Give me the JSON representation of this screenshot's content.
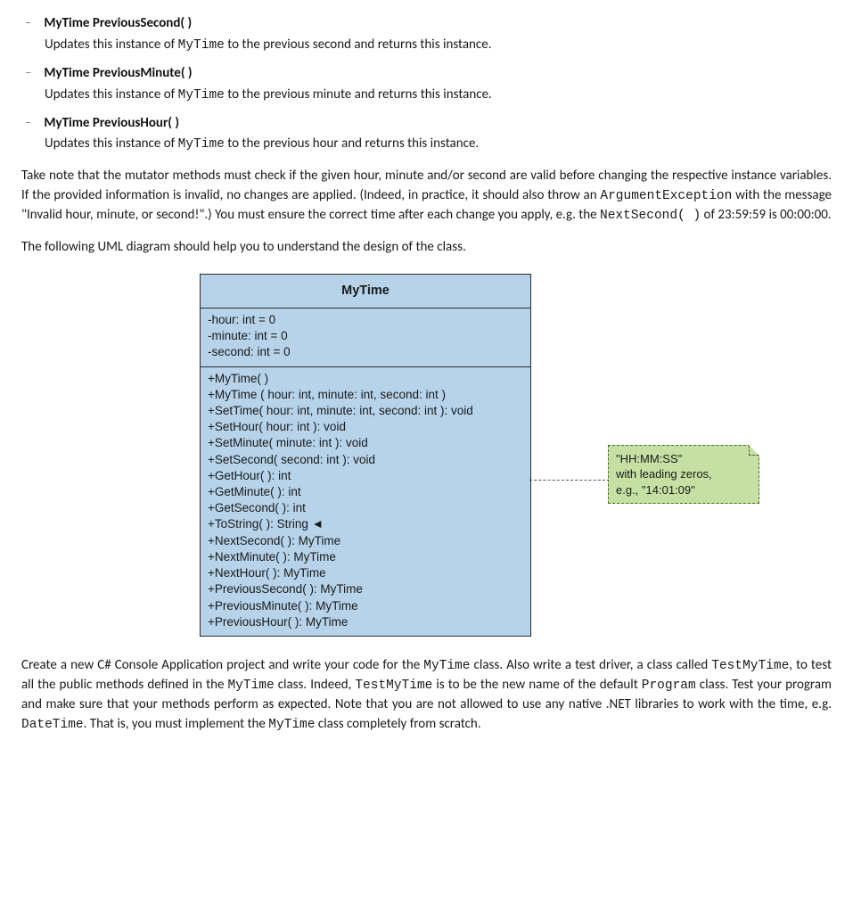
{
  "methods": [
    {
      "sig": "MyTime PreviousSecond( )",
      "desc_pre": "Updates this instance of ",
      "desc_mono": "MyTime",
      "desc_post": " to the previous second and returns this instance."
    },
    {
      "sig": "MyTime PreviousMinute( )",
      "desc_pre": "Updates this instance of ",
      "desc_mono": "MyTime",
      "desc_post": " to the previous minute and returns this instance."
    },
    {
      "sig": "MyTime PreviousHour( )",
      "desc_pre": "Updates this instance of ",
      "desc_mono": "MyTime",
      "desc_post": " to the previous hour and returns this instance."
    }
  ],
  "para1": {
    "s1": "Take note that the mutator methods must check if the given hour, minute and/or second are valid before changing the respective instance variables. If the provided information is invalid, no changes are applied. (Indeed, in practice, it should also throw an ",
    "mono1": "ArgumentException",
    "s2": " with the message \"Invalid hour, minute, or second!\".) You must ensure the correct time after each change you apply, e.g. the ",
    "mono2": "NextSecond( )",
    "s3": " of 23:59:59 is 00:00:00."
  },
  "para2": "The following UML diagram should help you to understand the design of the class.",
  "uml": {
    "title": "MyTime",
    "attrs": [
      "-hour: int = 0",
      "-minute: int = 0",
      "-second: int = 0"
    ],
    "ops": [
      "+MyTime( )",
      "+MyTime ( hour: int, minute: int, second: int )",
      "+SetTime( hour: int, minute: int, second: int ): void",
      "+SetHour( hour: int ): void",
      "+SetMinute( minute: int ): void",
      "+SetSecond( second: int ): void",
      "+GetHour( ): int",
      "+GetMinute( ): int",
      "+GetSecond( ): int",
      "+ToString( ): String ◄",
      "+NextSecond( ): MyTime",
      "+NextMinute( ): MyTime",
      "+NextHour( ): MyTime",
      "+PreviousSecond( ): MyTime",
      "+PreviousMinute( ): MyTime",
      "+PreviousHour( ): MyTime"
    ]
  },
  "note": {
    "l1": "\"HH:MM:SS\"",
    "l2": "with leading zeros,",
    "l3": "e.g., \"14:01:09\""
  },
  "para3": {
    "s1": "Create a new C# Console Application project and write your code for the ",
    "mono1": "MyTime",
    "s2": " class. Also write a test driver, a class called ",
    "mono2": "TestMyTime",
    "s3": ", to test all the public methods defined in the ",
    "mono3": "MyTime",
    "s4": " class. Indeed, ",
    "mono4": "TestMyTime",
    "s5": " is to be the new name of the default ",
    "mono5": "Program",
    "s6": " class. Test your program and make sure that your methods perform as expected. Note that you are not allowed to use any native .NET libraries to work with the time, e.g.  ",
    "mono6": "DateTime",
    "s7": ". That is, you must implement the ",
    "mono7": "MyTime",
    "s8": " class completely from scratch."
  }
}
